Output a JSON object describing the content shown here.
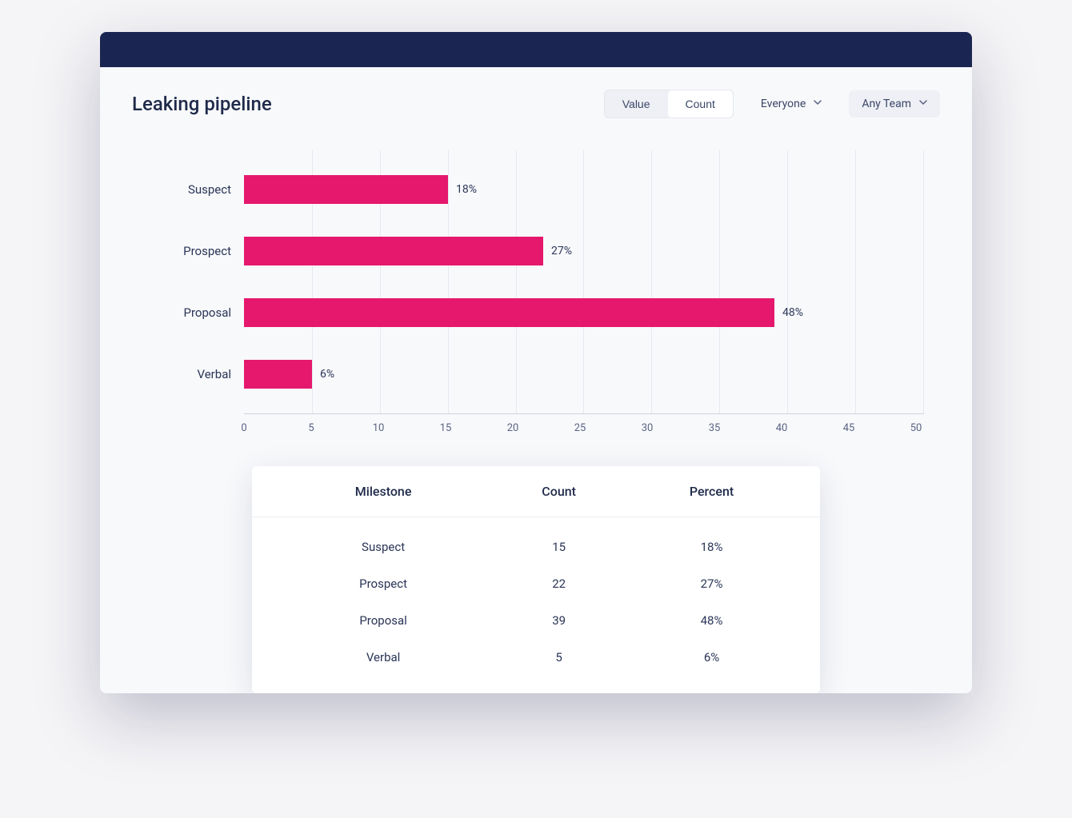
{
  "title": "Leaking pipeline",
  "toggle": {
    "value_label": "Value",
    "count_label": "Count",
    "active": "count"
  },
  "filters": {
    "person": "Everyone",
    "team": "Any Team"
  },
  "colors": {
    "bar": "#e5186e"
  },
  "chart_data": {
    "type": "bar",
    "orientation": "horizontal",
    "categories": [
      "Suspect",
      "Prospect",
      "Proposal",
      "Verbal"
    ],
    "values": [
      15,
      22,
      39,
      5
    ],
    "percent_labels": [
      "18%",
      "27%",
      "48%",
      "6%"
    ],
    "xlim": [
      0,
      50
    ],
    "xticks": [
      0,
      5,
      10,
      15,
      20,
      25,
      30,
      35,
      40,
      45,
      50
    ],
    "title": "",
    "xlabel": "",
    "ylabel": ""
  },
  "table": {
    "headers": [
      "Milestone",
      "Count",
      "Percent"
    ],
    "rows": [
      {
        "milestone": "Suspect",
        "count": "15",
        "percent": "18%"
      },
      {
        "milestone": "Prospect",
        "count": "22",
        "percent": "27%"
      },
      {
        "milestone": "Proposal",
        "count": "39",
        "percent": "48%"
      },
      {
        "milestone": "Verbal",
        "count": "5",
        "percent": "6%"
      }
    ]
  }
}
